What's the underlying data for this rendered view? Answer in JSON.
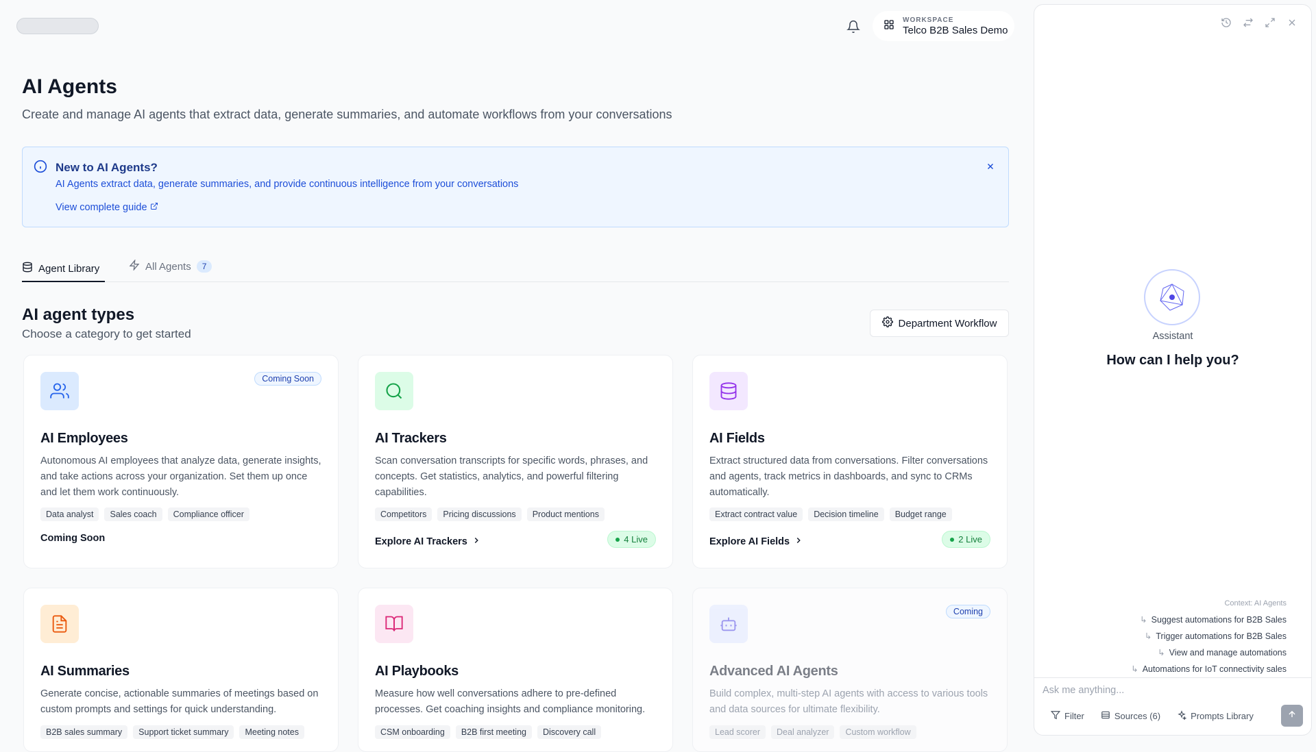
{
  "header": {
    "workspace_label": "WORKSPACE",
    "workspace_name": "Telco B2B Sales Demo"
  },
  "page": {
    "title": "AI Agents",
    "subtitle": "Create and manage AI agents that extract data, generate summaries, and automate workflows from your conversations"
  },
  "info_banner": {
    "title": "New to AI Agents?",
    "description": "AI Agents extract data, generate summaries, and provide continuous intelligence from your conversations",
    "guide_link": "View complete guide"
  },
  "tabs": [
    {
      "label": "Agent Library",
      "active": true
    },
    {
      "label": "All Agents",
      "count": "7",
      "active": false
    }
  ],
  "section": {
    "title": "AI agent types",
    "subtitle": "Choose a category to get started",
    "department_button": "Department Workflow"
  },
  "cards": [
    {
      "title": "AI Employees",
      "badge": "Coming Soon",
      "description": "Autonomous AI employees that analyze data, generate insights, and take actions across your organization. Set them up once and let them work continuously.",
      "tags": [
        "Data analyst",
        "Sales coach",
        "Compliance officer"
      ],
      "cta": "Coming Soon"
    },
    {
      "title": "AI Trackers",
      "description": "Scan conversation transcripts for specific words, phrases, and concepts. Get statistics, analytics, and powerful filtering capabilities.",
      "tags": [
        "Competitors",
        "Pricing discussions",
        "Product mentions"
      ],
      "cta": "Explore AI Trackers",
      "live": "4 Live"
    },
    {
      "title": "AI Fields",
      "description": "Extract structured data from conversations. Filter conversations and agents, track metrics in dashboards, and sync to CRMs automatically.",
      "tags": [
        "Extract contract value",
        "Decision timeline",
        "Budget range"
      ],
      "cta": "Explore AI Fields",
      "live": "2 Live"
    },
    {
      "title": "AI Summaries",
      "description": "Generate concise, actionable summaries of meetings based on custom prompts and settings for quick understanding.",
      "tags": [
        "B2B sales summary",
        "Support ticket summary",
        "Meeting notes"
      ]
    },
    {
      "title": "AI Playbooks",
      "description": "Measure how well conversations adhere to pre-defined processes. Get coaching insights and compliance monitoring.",
      "tags": [
        "CSM onboarding",
        "B2B first meeting",
        "Discovery call"
      ]
    },
    {
      "title": "Advanced AI Agents",
      "badge": "Coming",
      "description": "Build complex, multi-step AI agents with access to various tools and data sources for ultimate flexibility.",
      "tags": [
        "Lead scorer",
        "Deal analyzer",
        "Custom workflow"
      ]
    }
  ],
  "assistant": {
    "name": "Assistant",
    "greeting": "How can I help you?",
    "context": "Context: AI Agents",
    "suggestions": [
      "Suggest automations for B2B Sales",
      "Trigger automations for B2B Sales",
      "View and manage automations",
      "Automations for IoT connectivity sales"
    ],
    "input_placeholder": "Ask me anything...",
    "filter_label": "Filter",
    "sources_label": "Sources (6)",
    "prompts_label": "Prompts Library"
  },
  "colors": {
    "employees_icon_bg": "#dbeafe",
    "trackers_icon_bg": "#dcfce7",
    "fields_icon_bg": "#f3e8ff",
    "summaries_icon_bg": "#ffedd5",
    "playbooks_icon_bg": "#fce7f3",
    "advanced_icon_bg": "#e0e7ff"
  }
}
